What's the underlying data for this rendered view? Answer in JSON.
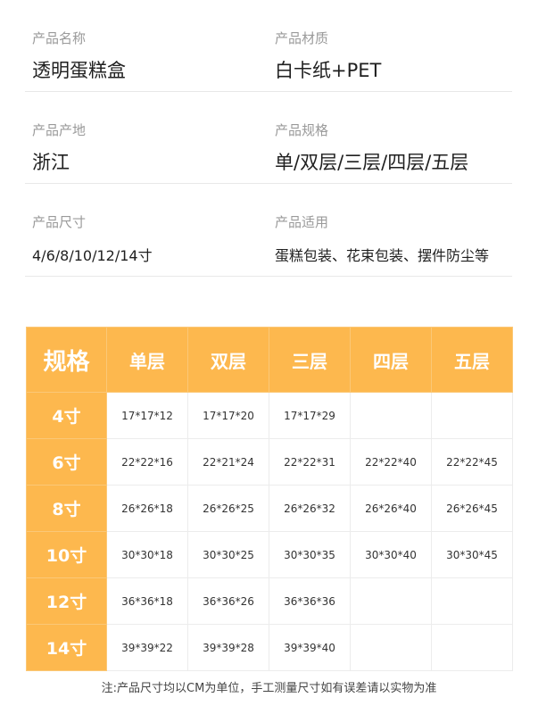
{
  "product_info": [
    {
      "left": {
        "label": "产品名称",
        "value": "透明蛋糕盒"
      },
      "right": {
        "label": "产品材质",
        "value": "白卡纸+PET"
      }
    },
    {
      "left": {
        "label": "产品产地",
        "value": "浙江"
      },
      "right": {
        "label": "产品规格",
        "value": "单/双层/三层/四层/五层"
      }
    },
    {
      "left": {
        "label": "产品尺寸",
        "value": "4/6/8/10/12/14寸"
      },
      "right": {
        "label": "产品适用",
        "value": "蛋糕包装、花束包装、摆件防尘等"
      }
    }
  ],
  "spec_table": {
    "corner": "规格",
    "headers": [
      "单层",
      "双层",
      "三层",
      "四层",
      "五层"
    ],
    "rows": [
      {
        "size": "4寸",
        "cells": [
          "17*17*12",
          "17*17*20",
          "17*17*29",
          "",
          ""
        ]
      },
      {
        "size": "6寸",
        "cells": [
          "22*22*16",
          "22*21*24",
          "22*22*31",
          "22*22*40",
          "22*22*45"
        ]
      },
      {
        "size": "8寸",
        "cells": [
          "26*26*18",
          "26*26*25",
          "26*26*32",
          "26*26*40",
          "26*26*45"
        ]
      },
      {
        "size": "10寸",
        "cells": [
          "30*30*18",
          "30*30*25",
          "30*30*35",
          "30*30*40",
          "30*30*45"
        ]
      },
      {
        "size": "12寸",
        "cells": [
          "36*36*18",
          "36*36*26",
          "36*36*36",
          "",
          ""
        ]
      },
      {
        "size": "14寸",
        "cells": [
          "39*39*22",
          "39*39*28",
          "39*39*40",
          "",
          ""
        ]
      }
    ]
  },
  "footnote": "注:产品尺寸均以CM为单位，手工测量尺寸如有误差请以实物为准",
  "colors": {
    "accent": "#fdb84e",
    "label": "#9a9a9a",
    "divider": "#e8e8e8"
  }
}
